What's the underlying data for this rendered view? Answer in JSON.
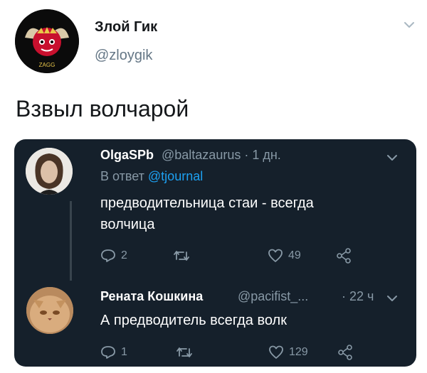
{
  "tweet": {
    "author_name": "Злой Гик",
    "author_handle": "@zloygik",
    "avatar_caption": "ZAGG",
    "text": "Взвыл волчарой"
  },
  "embedded": {
    "reply1": {
      "name": "OlgaSPb",
      "handle_time": "@baltazaurus · 1 дн.",
      "reply_prefix": "В ответ",
      "reply_mention": "@tjournal",
      "text_line1": "предводительница стаи - всегда",
      "text_line2": "волчица",
      "replies": "2",
      "retweets": "",
      "likes": "49"
    },
    "reply2": {
      "name": "Рената Кошкина",
      "handle_time": "@pacifist_...",
      "time": "· 22 ч",
      "text": "А предводитель всегда волк",
      "replies": "1",
      "retweets": "",
      "likes": "129"
    }
  },
  "icons": [
    "chevron-down-icon",
    "reply-icon",
    "retweet-icon",
    "like-icon",
    "share-icon"
  ],
  "colors": {
    "card_bg": "#15202b",
    "mention": "#1da1f2",
    "muted": "#8899a6"
  }
}
